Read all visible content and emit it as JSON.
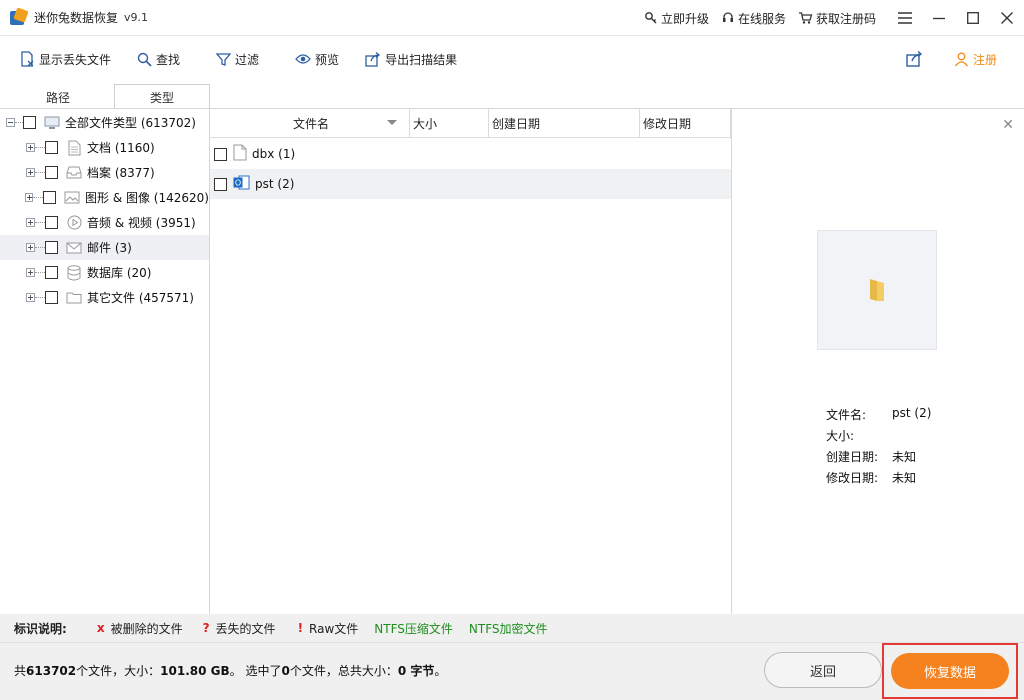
{
  "app": {
    "title": "迷你兔数据恢复",
    "version": "v9.1"
  },
  "title_actions": {
    "upgrade": "立即升级",
    "online_service": "在线服务",
    "get_code": "获取注册码"
  },
  "toolbar": {
    "show_lost": "显示丢失文件",
    "find": "查找",
    "filter": "过滤",
    "preview": "预览",
    "export": "导出扫描结果",
    "register": "注册"
  },
  "tabs": {
    "path": "路径",
    "type": "类型"
  },
  "tree": {
    "root": "全部文件类型 (613702)",
    "items": [
      {
        "label": "文档 (1160)",
        "icon": "document-icon"
      },
      {
        "label": "档案 (8377)",
        "icon": "archive-icon"
      },
      {
        "label": "图形 & 图像 (142620)",
        "icon": "image-icon"
      },
      {
        "label": "音频 & 视频 (3951)",
        "icon": "media-icon"
      },
      {
        "label": "邮件 (3)",
        "icon": "mail-icon"
      },
      {
        "label": "数据库 (20)",
        "icon": "database-icon"
      },
      {
        "label": "其它文件 (457571)",
        "icon": "folder-icon"
      }
    ]
  },
  "table": {
    "columns": {
      "name": "文件名",
      "size": "大小",
      "created": "创建日期",
      "modified": "修改日期"
    },
    "rows": [
      {
        "name": "dbx (1)",
        "icon": "file-icon"
      },
      {
        "name": "pst (2)",
        "icon": "outlook-icon"
      }
    ]
  },
  "preview": {
    "labels": {
      "filename": "文件名:",
      "size": "大小:",
      "created": "创建日期:",
      "modified": "修改日期:"
    },
    "values": {
      "filename": "pst (2)",
      "size": "",
      "created": "未知",
      "modified": "未知"
    }
  },
  "legend": {
    "title": "标识说明:",
    "deleted_mark": "x",
    "deleted": "被删除的文件",
    "lost_mark": "?",
    "lost": "丢失的文件",
    "raw_mark": "!",
    "raw": "Raw文件",
    "ntfs_compressed": "NTFS压缩文件",
    "ntfs_encrypted": "NTFS加密文件"
  },
  "status": {
    "p1": "共",
    "count": "613702",
    "p2": "个文件，大小：",
    "size": "101.80 GB",
    "p3": "。 选中了",
    "selected": "0",
    "p4": "个文件，总共大小：",
    "selected_size": "0 字节",
    "p5": "。"
  },
  "buttons": {
    "back": "返回",
    "recover": "恢复数据"
  },
  "colors": {
    "accent": "#f5821f",
    "ntfs_green": "#1e8f1e",
    "mark_red": "#e02020",
    "highlight_border": "#e53935"
  }
}
